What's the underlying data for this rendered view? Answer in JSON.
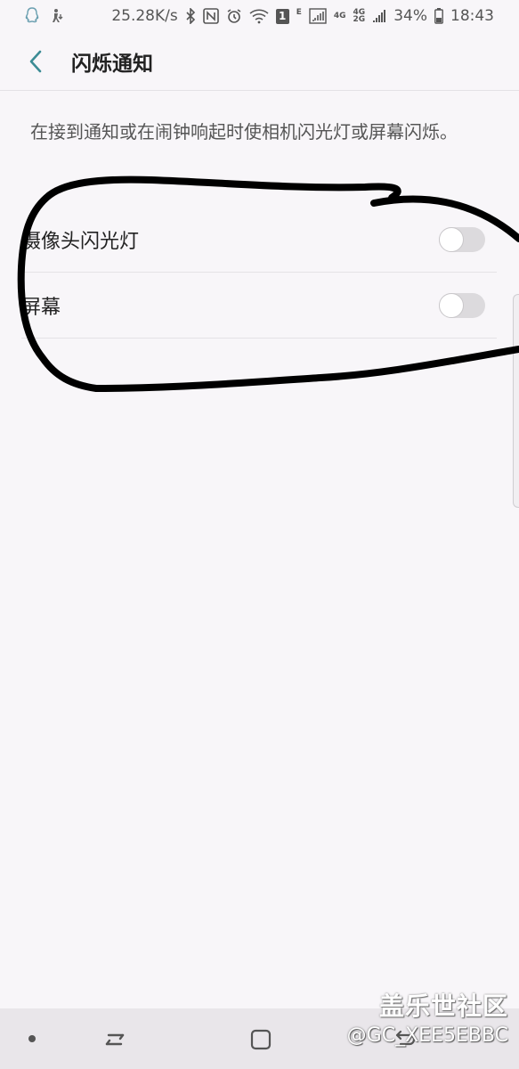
{
  "status_bar": {
    "network_speed": "25.28K/s",
    "sim_badge": "1",
    "net_e": "E",
    "net_4g_a": "4G",
    "net_4g_b": "4G",
    "net_2g": "2G",
    "battery": "34%",
    "time": "18:43"
  },
  "header": {
    "title": "闪烁通知"
  },
  "description": "在接到通知或在闹钟响起时使相机闪光灯或屏幕闪烁。",
  "settings": [
    {
      "label": "摄像头闪光灯",
      "enabled": false
    },
    {
      "label": "屏幕",
      "enabled": false
    }
  ],
  "watermark": {
    "site": "盖乐世社区",
    "user": "@GC_XEE5EBBC"
  },
  "colors": {
    "accent": "#3c8c95",
    "background": "#f8f6f9",
    "toggle_off": "#dcdadd"
  }
}
